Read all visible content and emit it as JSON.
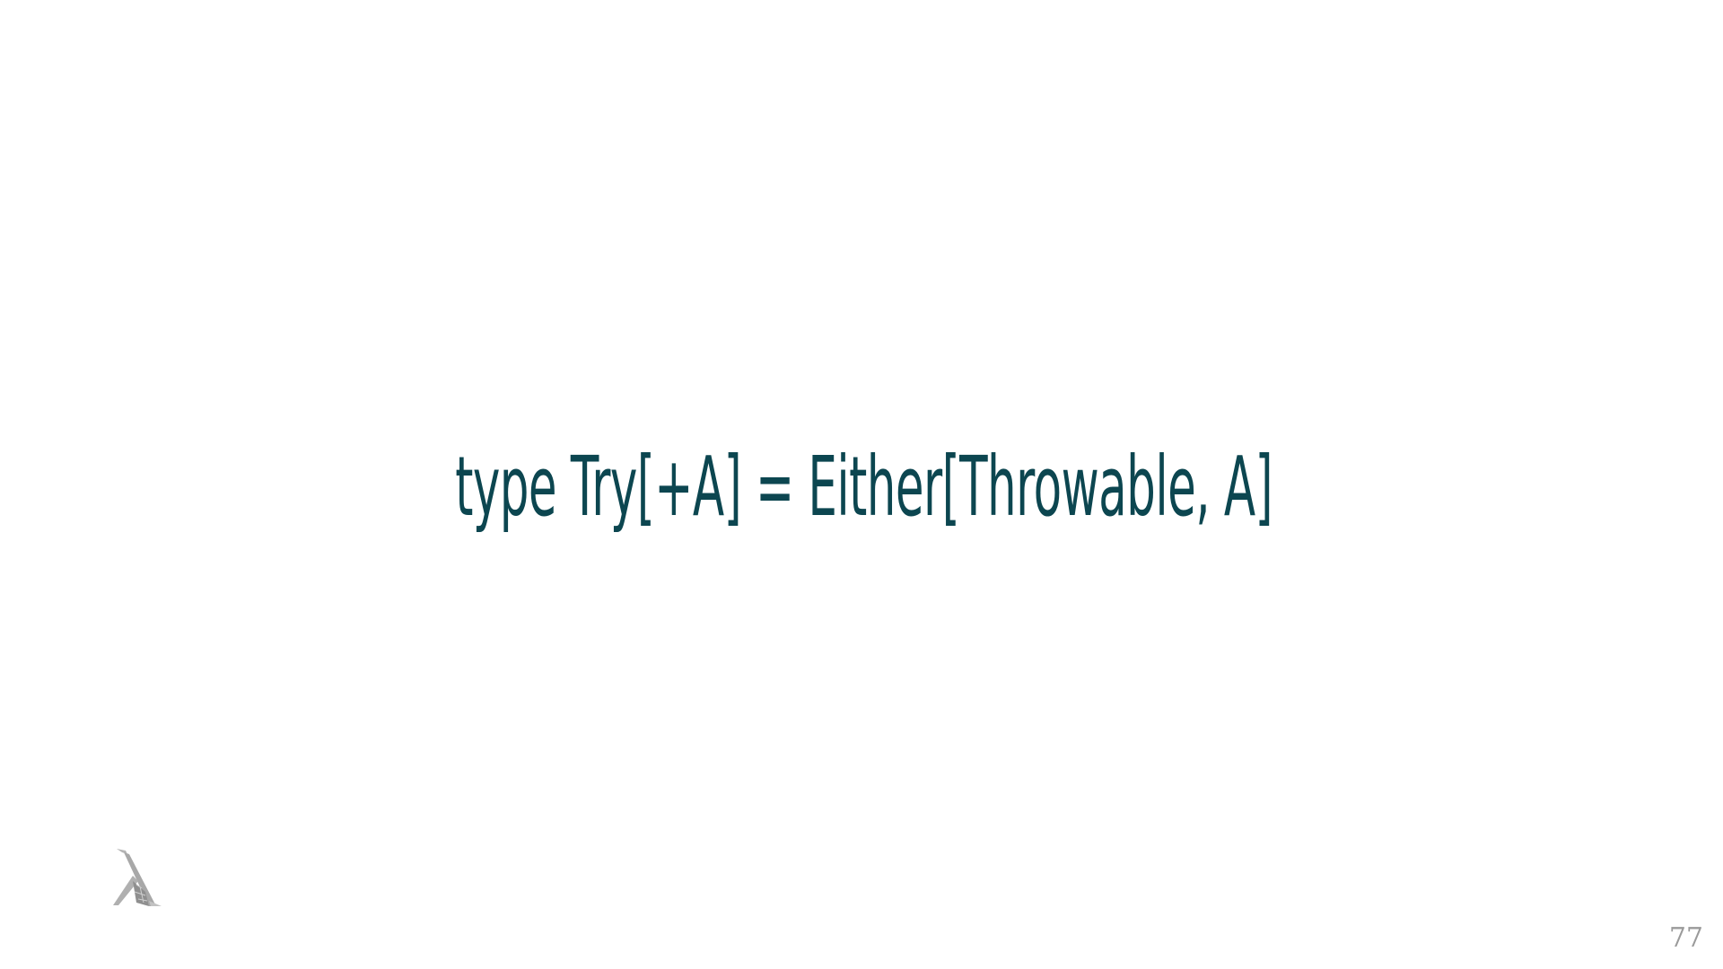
{
  "slide": {
    "code_text": "type Try[+A] = Either[Throwable, A]",
    "page_number": "77",
    "text_color": "#0c4650",
    "logo_icon": "lambda-logo-icon"
  }
}
